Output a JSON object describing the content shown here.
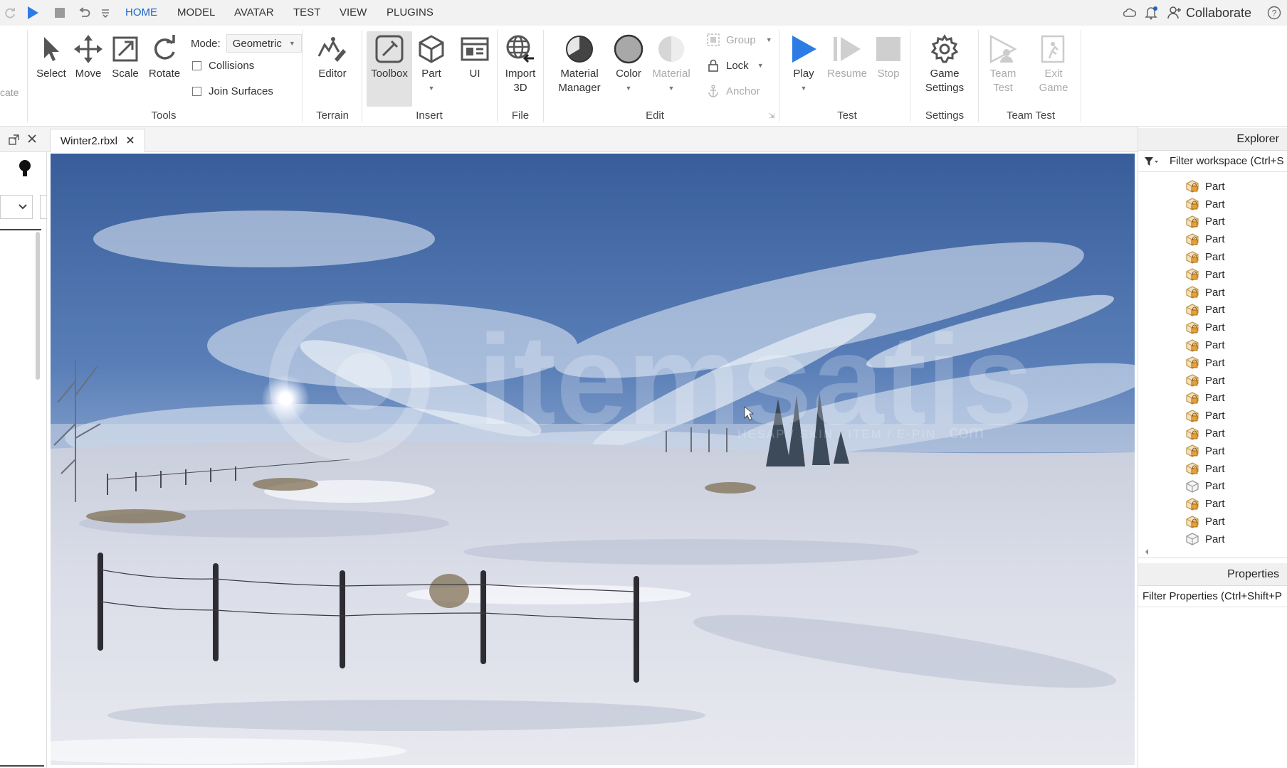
{
  "menubar": {
    "tabs": [
      {
        "label": "HOME",
        "active": true
      },
      {
        "label": "MODEL",
        "active": false
      },
      {
        "label": "AVATAR",
        "active": false
      },
      {
        "label": "TEST",
        "active": false
      },
      {
        "label": "VIEW",
        "active": false
      },
      {
        "label": "PLUGINS",
        "active": false
      }
    ],
    "collaborate_label": "Collaborate"
  },
  "ribbon": {
    "left_cut_label": "cate",
    "tools": {
      "select": "Select",
      "move": "Move",
      "scale": "Scale",
      "rotate": "Rotate",
      "mode_label": "Mode:",
      "mode_value": "Geometric",
      "collisions": "Collisions",
      "join_surfaces": "Join Surfaces",
      "group_label": "Tools"
    },
    "terrain": {
      "editor": "Editor",
      "group_label": "Terrain"
    },
    "insert": {
      "toolbox": "Toolbox",
      "part": "Part",
      "ui": "UI",
      "group_label": "Insert"
    },
    "file": {
      "import_line1": "Import",
      "import_line2": "3D",
      "group_label": "File"
    },
    "edit": {
      "material_manager_line1": "Material",
      "material_manager_line2": "Manager",
      "color": "Color",
      "material": "Material",
      "group": "Group",
      "lock": "Lock",
      "anchor": "Anchor",
      "group_label": "Edit"
    },
    "test": {
      "play": "Play",
      "resume": "Resume",
      "stop": "Stop",
      "group_label": "Test"
    },
    "settings": {
      "game_line1": "Game",
      "game_line2": "Settings",
      "group_label": "Settings"
    },
    "team_test": {
      "team_test_line1": "Team",
      "team_test_line2": "Test",
      "exit_game_line1": "Exit",
      "exit_game_line2": "Game",
      "group_label": "Team Test"
    }
  },
  "document": {
    "tab_title": "Winter2.rbxl"
  },
  "viewport": {
    "watermark_text": "itemsatis",
    "watermark_sub": "HESAP / SKIN / ITEM / E-PIN",
    "watermark_com": ".com"
  },
  "explorer": {
    "title": "Explorer",
    "filter_placeholder": "Filter workspace (Ctrl+S",
    "items": [
      {
        "label": "Part",
        "locked": true
      },
      {
        "label": "Part",
        "locked": true
      },
      {
        "label": "Part",
        "locked": true
      },
      {
        "label": "Part",
        "locked": true
      },
      {
        "label": "Part",
        "locked": true
      },
      {
        "label": "Part",
        "locked": true
      },
      {
        "label": "Part",
        "locked": true
      },
      {
        "label": "Part",
        "locked": true
      },
      {
        "label": "Part",
        "locked": true
      },
      {
        "label": "Part",
        "locked": true
      },
      {
        "label": "Part",
        "locked": true
      },
      {
        "label": "Part",
        "locked": true
      },
      {
        "label": "Part",
        "locked": true
      },
      {
        "label": "Part",
        "locked": true
      },
      {
        "label": "Part",
        "locked": true
      },
      {
        "label": "Part",
        "locked": true
      },
      {
        "label": "Part",
        "locked": true
      },
      {
        "label": "Part",
        "locked": false
      },
      {
        "label": "Part",
        "locked": true
      },
      {
        "label": "Part",
        "locked": true
      },
      {
        "label": "Part",
        "locked": false
      }
    ]
  },
  "properties": {
    "title": "Properties",
    "filter_placeholder": "Filter Properties (Ctrl+Shift+P"
  },
  "colors": {
    "accent": "#1a64c8",
    "play": "#2d7be5"
  }
}
